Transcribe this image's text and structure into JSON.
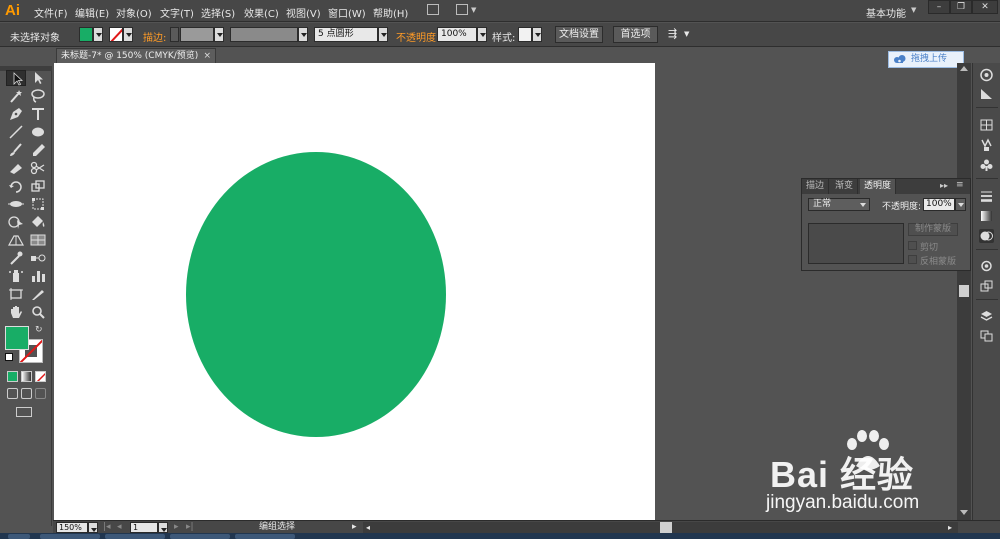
{
  "app": {
    "logo": "Ai",
    "menu": [
      "文件(F)",
      "编辑(E)",
      "对象(O)",
      "文字(T)",
      "选择(S)",
      "效果(C)",
      "视图(V)",
      "窗口(W)",
      "帮助(H)"
    ],
    "workspace": "基本功能",
    "window_buttons": [
      "–",
      "❐",
      "✕"
    ]
  },
  "controlbar": {
    "selection_label": "未选择对象",
    "stroke_label": "描边:",
    "brush_value": "5 点圆形",
    "opacity_label": "不透明度:",
    "opacity_value": "100%",
    "style_label": "样式:",
    "doc_setup_button": "文档设置",
    "preferences_button": "首选项"
  },
  "document": {
    "tab_title": "未标题-7* @ 150% (CMYK/预览)",
    "tab_close": "×"
  },
  "upload_button": "拖拽上传",
  "transparency_panel": {
    "tabs": [
      "描边",
      "渐变",
      "透明度"
    ],
    "active_tab": "透明度",
    "blend_mode": "正常",
    "opacity_label": "不透明度:",
    "opacity_value": "100%",
    "make_mask_button": "制作蒙版",
    "clip_label": "剪切",
    "invert_label": "反相蒙版"
  },
  "statusbar": {
    "zoom": "150%",
    "page": "1",
    "status_text": "编组选择"
  },
  "watermark": {
    "logo_text": "Bai 经验",
    "url": "jingyan.baidu.com"
  },
  "colors": {
    "fill": "#18ad66",
    "ellipse": "#18ad66",
    "stroke_none_slash": "#e01818",
    "accent_orange": "#ff9b26"
  }
}
